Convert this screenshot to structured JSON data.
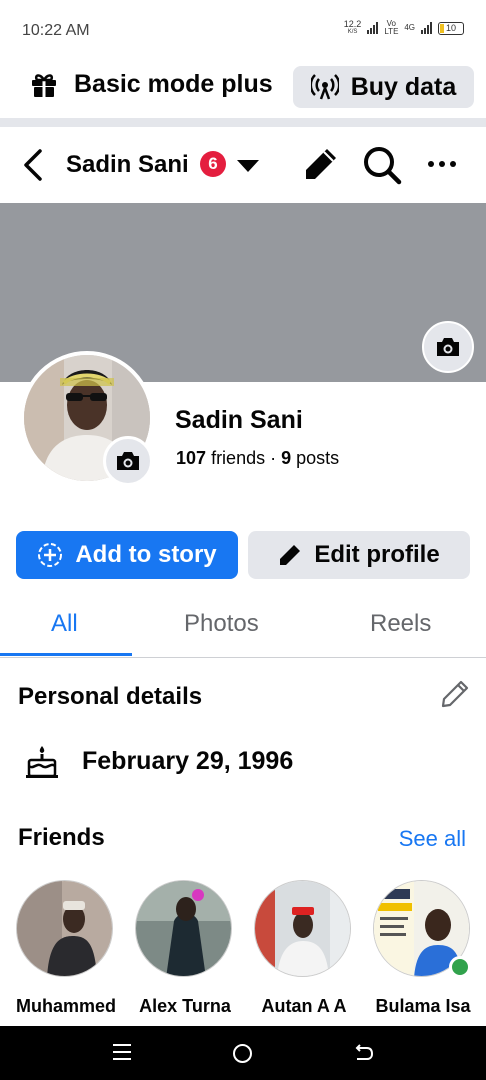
{
  "status_bar": {
    "time": "10:22 AM",
    "net_speed_value": "12.2",
    "net_speed_unit": "K/S",
    "net_type": "Vo LTE",
    "net_gen": "4G",
    "battery": "10"
  },
  "basic_mode": {
    "label": "Basic mode plus",
    "buy_data_label": "Buy data"
  },
  "header": {
    "name": "Sadin Sani",
    "notification_count": "6"
  },
  "profile": {
    "name": "Sadin Sani",
    "friends_count": "107",
    "friends_label": "friends ·",
    "posts_count": "9",
    "posts_label": "posts"
  },
  "actions": {
    "add_story_label": "Add to story",
    "edit_profile_label": "Edit profile"
  },
  "tabs": [
    {
      "label": "All"
    },
    {
      "label": "Photos"
    },
    {
      "label": "Reels"
    }
  ],
  "personal_details": {
    "title": "Personal details",
    "birthday": "February 29, 1996"
  },
  "friends": {
    "title": "Friends",
    "see_all_label": "See all",
    "items": [
      {
        "name": "Muhammed"
      },
      {
        "name": "Alex Turna"
      },
      {
        "name": "Autan A A"
      },
      {
        "name": "Bulama Isa"
      }
    ]
  },
  "colors": {
    "accent": "#1877f2",
    "badge": "#e41e3f",
    "online": "#31a24c",
    "cover": "#96999e"
  }
}
